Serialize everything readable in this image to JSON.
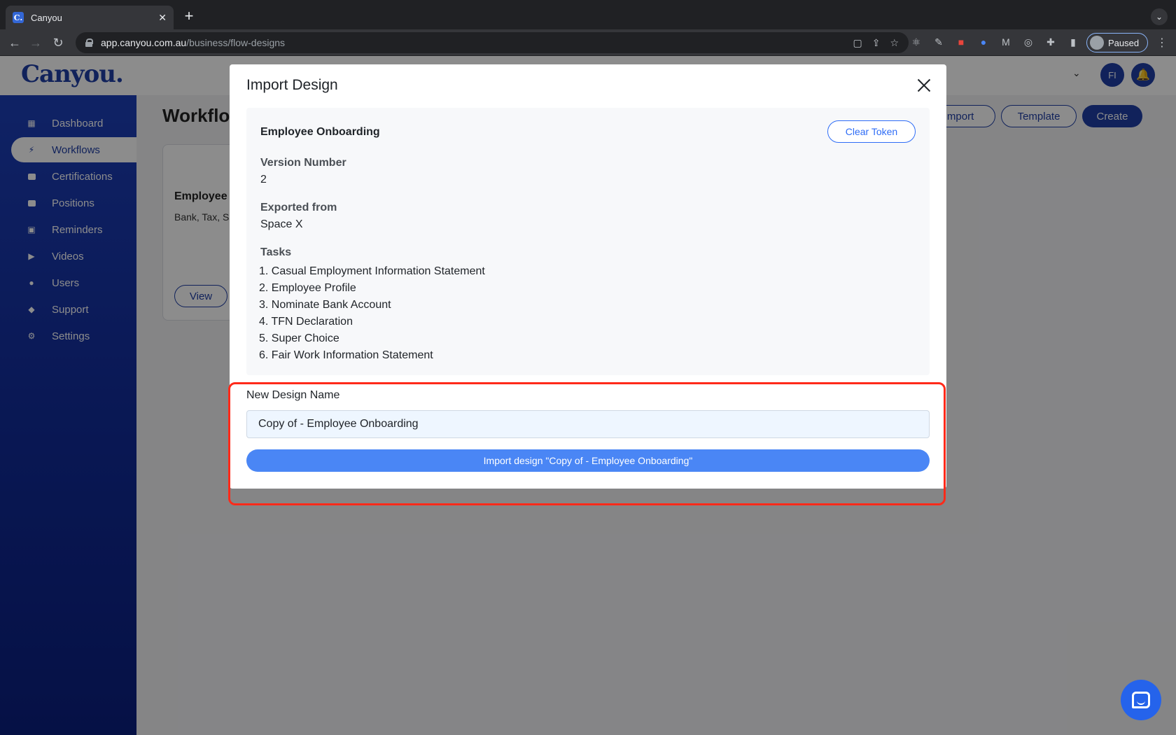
{
  "browser": {
    "tab_title": "Canyou",
    "favicon_letter": "C.",
    "url_host": "app.canyou.com.au",
    "url_path": "/business/flow-designs",
    "profile_label": "Paused"
  },
  "app": {
    "logo": "Canyou.",
    "avatar_initials": "FI",
    "page_title": "Workflo",
    "header_buttons": {
      "import": "Import",
      "template": "Template",
      "create": "Create"
    },
    "sidebar": {
      "items": [
        {
          "label": "Dashboard",
          "icon": "grid-icon"
        },
        {
          "label": "Workflows",
          "icon": "bolt-icon"
        },
        {
          "label": "Certifications",
          "icon": "briefcase-icon"
        },
        {
          "label": "Positions",
          "icon": "briefcase-icon"
        },
        {
          "label": "Reminders",
          "icon": "calendar-icon"
        },
        {
          "label": "Videos",
          "icon": "video-icon"
        },
        {
          "label": "Users",
          "icon": "user-icon"
        },
        {
          "label": "Support",
          "icon": "chat-icon"
        },
        {
          "label": "Settings",
          "icon": "gear-icon"
        }
      ],
      "active_index": 1
    },
    "card": {
      "title": "Employee Onboardi",
      "description": "Bank, Tax, S Work inforr",
      "view_label": "View"
    }
  },
  "modal": {
    "title": "Import Design",
    "design_name": "Employee Onboarding",
    "clear_token_label": "Clear Token",
    "version_label": "Version Number",
    "version_value": "2",
    "exported_label": "Exported from",
    "exported_value": "Space X",
    "tasks_label": "Tasks",
    "tasks": [
      "1. Casual Employment Information Statement",
      "2. Employee Profile",
      "3. Nominate Bank Account",
      "4. TFN Declaration",
      "5. Super Choice",
      "6. Fair Work Information Statement"
    ],
    "new_name_label": "New Design Name",
    "new_name_value": "Copy of - Employee Onboarding",
    "import_button_label": "Import design \"Copy of - Employee Onboarding\""
  },
  "colors": {
    "brand": "#1f3fa6",
    "accent": "#2f6df6",
    "highlight": "#ff2a1a"
  }
}
